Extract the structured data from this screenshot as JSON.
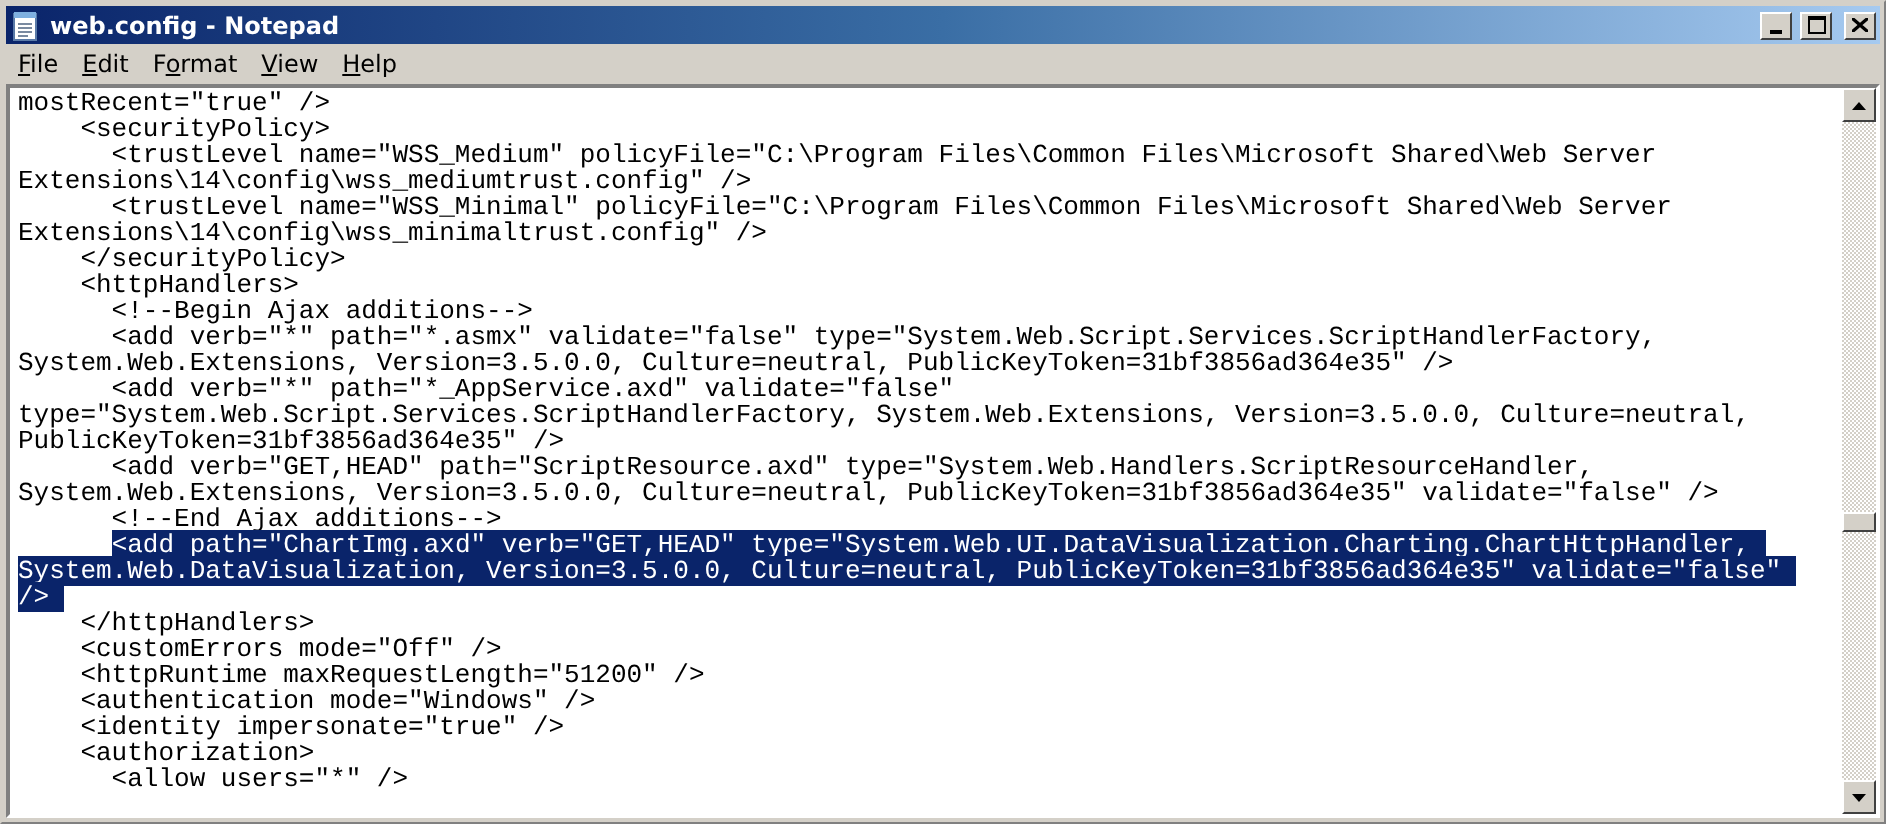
{
  "window": {
    "title": "web.config - Notepad"
  },
  "title_buttons": [
    {
      "kind": "minimize"
    },
    {
      "kind": "maximize"
    },
    {
      "kind": "close"
    }
  ],
  "menu": [
    {
      "access_key": "F",
      "after": "ile"
    },
    {
      "access_key": "E",
      "after": "dit"
    },
    {
      "before": "F",
      "access_key": "o",
      "after": "rmat"
    },
    {
      "access_key": "V",
      "after": "iew"
    },
    {
      "access_key": "H",
      "after": "elp"
    }
  ],
  "lines": [
    {
      "text": "mostRecent=\"true\" />",
      "selected": false
    },
    {
      "text": "    <securityPolicy>",
      "selected": false
    },
    {
      "text": "      <trustLevel name=\"WSS_Medium\" policyFile=\"C:\\Program Files\\Common Files\\Microsoft Shared\\Web Server",
      "selected": false
    },
    {
      "text": "Extensions\\14\\config\\wss_mediumtrust.config\" />",
      "selected": false
    },
    {
      "text": "      <trustLevel name=\"WSS_Minimal\" policyFile=\"C:\\Program Files\\Common Files\\Microsoft Shared\\Web Server",
      "selected": false
    },
    {
      "text": "Extensions\\14\\config\\wss_minimaltrust.config\" />",
      "selected": false
    },
    {
      "text": "    </securityPolicy>",
      "selected": false
    },
    {
      "text": "    <httpHandlers>",
      "selected": false
    },
    {
      "text": "      <!--Begin Ajax additions-->",
      "selected": false
    },
    {
      "text": "      <add verb=\"*\" path=\"*.asmx\" validate=\"false\" type=\"System.Web.Script.Services.ScriptHandlerFactory,",
      "selected": false
    },
    {
      "text": "System.Web.Extensions, Version=3.5.0.0, Culture=neutral, PublicKeyToken=31bf3856ad364e35\" />",
      "selected": false
    },
    {
      "text": "      <add verb=\"*\" path=\"*_AppService.axd\" validate=\"false\"",
      "selected": false
    },
    {
      "text": "type=\"System.Web.Script.Services.ScriptHandlerFactory, System.Web.Extensions, Version=3.5.0.0, Culture=neutral,",
      "selected": false
    },
    {
      "text": "PublicKeyToken=31bf3856ad364e35\" />",
      "selected": false
    },
    {
      "text": "      <add verb=\"GET,HEAD\" path=\"ScriptResource.axd\" type=\"System.Web.Handlers.ScriptResourceHandler,",
      "selected": false
    },
    {
      "text": "System.Web.Extensions, Version=3.5.0.0, Culture=neutral, PublicKeyToken=31bf3856ad364e35\" validate=\"false\" />",
      "selected": false
    },
    {
      "text": "      <!--End Ajax additions-->",
      "selected": false
    },
    {
      "text": "      <add path=\"ChartImg.axd\" verb=\"GET,HEAD\" type=\"System.Web.UI.DataVisualization.Charting.ChartHttpHandler,",
      "selected": true
    },
    {
      "text": "System.Web.DataVisualization, Version=3.5.0.0, Culture=neutral, PublicKeyToken=31bf3856ad364e35\" validate=\"false\"",
      "selected": true
    },
    {
      "text": "/>",
      "selected": true
    },
    {
      "text": "    </httpHandlers>",
      "selected": false
    },
    {
      "text": "    <customErrors mode=\"Off\" />",
      "selected": false
    },
    {
      "text": "    <httpRuntime maxRequestLength=\"51200\" />",
      "selected": false
    },
    {
      "text": "    <authentication mode=\"Windows\" />",
      "selected": false
    },
    {
      "text": "    <identity impersonate=\"true\" />",
      "selected": false
    },
    {
      "text": "    <authorization>",
      "selected": false
    },
    {
      "text": "      <allow users=\"*\" />",
      "selected": false
    }
  ]
}
